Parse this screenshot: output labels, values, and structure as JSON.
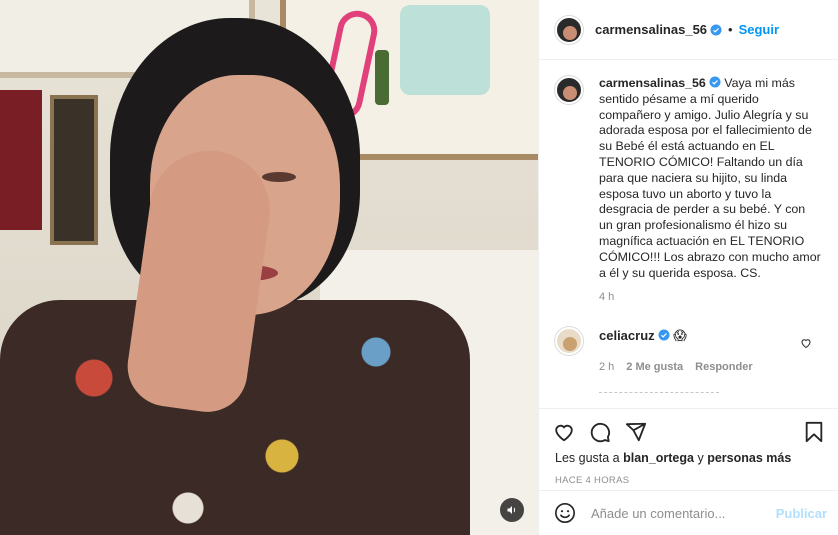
{
  "post": {
    "author": "carmensalinas_56",
    "follow_label": "Seguir",
    "separator": "•",
    "caption": "Vaya mi más sentido pésame a mí querido compañero y amigo. Julio Alegría y su adorada esposa por el fallecimiento de su Bebé él está actuando en EL TENORIO CÓMICO! Faltando un día para que naciera su hijito, su linda esposa tuvo un aborto y tuvo la desgracia de perder a su bebé. Y con un gran profesionalismo él hizo su magnífica actuación en EL TENORIO CÓMICO!!! Los abrazo con mucho amor a él y su querida esposa. CS.",
    "caption_time": "4 h"
  },
  "comment": {
    "author": "celiacruz",
    "text": "😱",
    "time": "2 h",
    "likes": "2 Me gusta",
    "reply_label": "Responder"
  },
  "likes": {
    "prefix": "Les gusta a",
    "user": "blan_ortega",
    "middle": "y",
    "others": "personas más"
  },
  "post_time": "HACE 4 HORAS",
  "add_comment": {
    "placeholder": "Añade un comentario...",
    "publish_label": "Publicar"
  },
  "colors": {
    "accent": "#0095f6",
    "verified": "#3897f0",
    "publish_disabled": "#b2dffc"
  }
}
